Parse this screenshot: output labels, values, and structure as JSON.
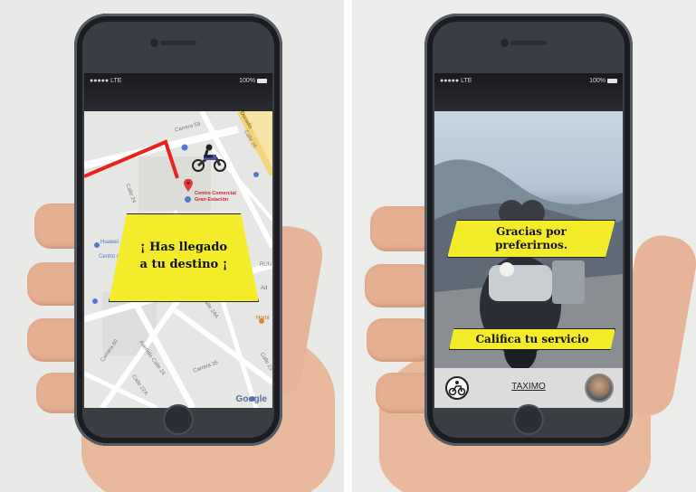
{
  "left_screen": {
    "status": {
      "signal": "●●●●● LTE",
      "battery": "100%"
    },
    "map": {
      "streets": [
        "Carrera 59",
        "Calle 26",
        "Dorado",
        "Calle 24",
        "Huawei",
        "Centro co",
        "RUN",
        "Ad",
        "Calle 24A",
        "Carrera 60",
        "Avenida Calle 24",
        "Carrera 35",
        "Horni",
        "Calle 22A",
        "Calle 23"
      ],
      "poi_line1": "Centro Comercial",
      "poi_line2": "Gran Estación",
      "attribution": "Google"
    },
    "banner_text": "¡ Has llegado a tu destino ¡"
  },
  "right_screen": {
    "status": {
      "signal": "●●●●● LTE",
      "battery": "100%"
    },
    "top_banner": "Gracias por preferirnos.",
    "bottom_banner": "Califica tu servicio",
    "tab_title": "TAXIMO"
  },
  "colors": {
    "route": "#e8221d",
    "banner": "#f4ec2a",
    "highway": "#f6e4a6"
  }
}
